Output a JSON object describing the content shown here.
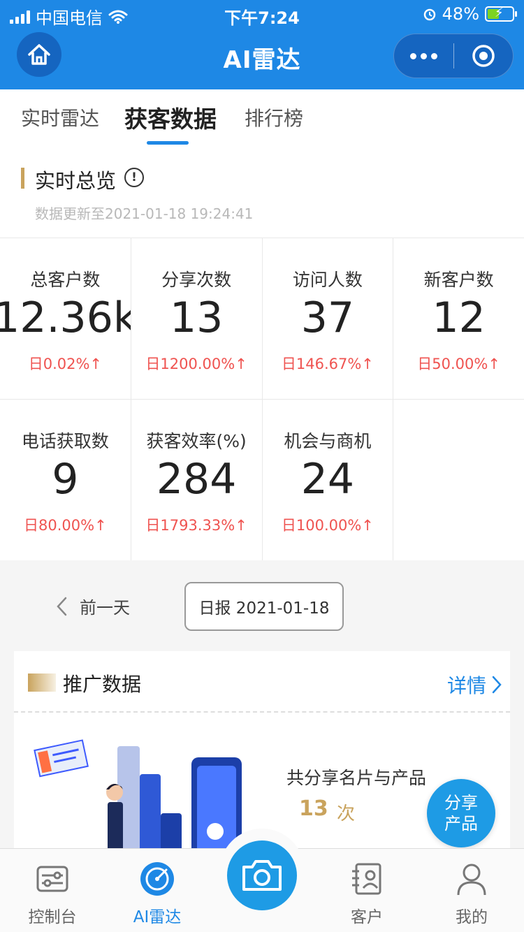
{
  "status_bar": {
    "carrier": "中国电信",
    "time": "下午7:24",
    "battery": "48%",
    "battery_level": 0.48
  },
  "nav": {
    "title": "AI雷达",
    "icons": [
      "home-icon",
      "more-icon",
      "target-icon"
    ]
  },
  "tabs": [
    {
      "label": "实时雷达",
      "active": false
    },
    {
      "label": "获客数据",
      "active": true
    },
    {
      "label": "排行榜",
      "active": false
    }
  ],
  "overview": {
    "title": "实时总览",
    "info_icon": "!",
    "updated": "数据更新至2021-01-18 19:24:41"
  },
  "stats": [
    {
      "label": "总客户数",
      "value": "12.36k",
      "change": "日0.02%↑"
    },
    {
      "label": "分享次数",
      "value": "13",
      "change": "日1200.00%↑"
    },
    {
      "label": "访问人数",
      "value": "37",
      "change": "日146.67%↑"
    },
    {
      "label": "新客户数",
      "value": "12",
      "change": "日50.00%↑"
    },
    {
      "label": "电话获取数",
      "value": "9",
      "change": "日80.00%↑"
    },
    {
      "label": "获客效率(%)",
      "value": "284",
      "change": "日1793.33%↑"
    },
    {
      "label": "机会与商机",
      "value": "24",
      "change": "日100.00%↑"
    }
  ],
  "date_nav": {
    "prev_label": "前一天",
    "current_label": "日报 2021-01-18"
  },
  "promo": {
    "title": "推广数据",
    "details_label": "详情",
    "summary_text": "共分享名片与产品",
    "count": "13",
    "unit": "次"
  },
  "share_fab": {
    "line1": "分享",
    "line2": "产品"
  },
  "tabbar": [
    {
      "label": "控制台",
      "icon": "console-icon",
      "active": false
    },
    {
      "label": "AI雷达",
      "icon": "radar-icon",
      "active": true
    },
    {
      "label": "客户",
      "icon": "customer-icon",
      "active": false
    },
    {
      "label": "我的",
      "icon": "profile-icon",
      "active": false
    }
  ],
  "colors": {
    "primary": "#1e88e5",
    "accent_gold": "#c9a35d",
    "increase_red": "#ef5350"
  }
}
